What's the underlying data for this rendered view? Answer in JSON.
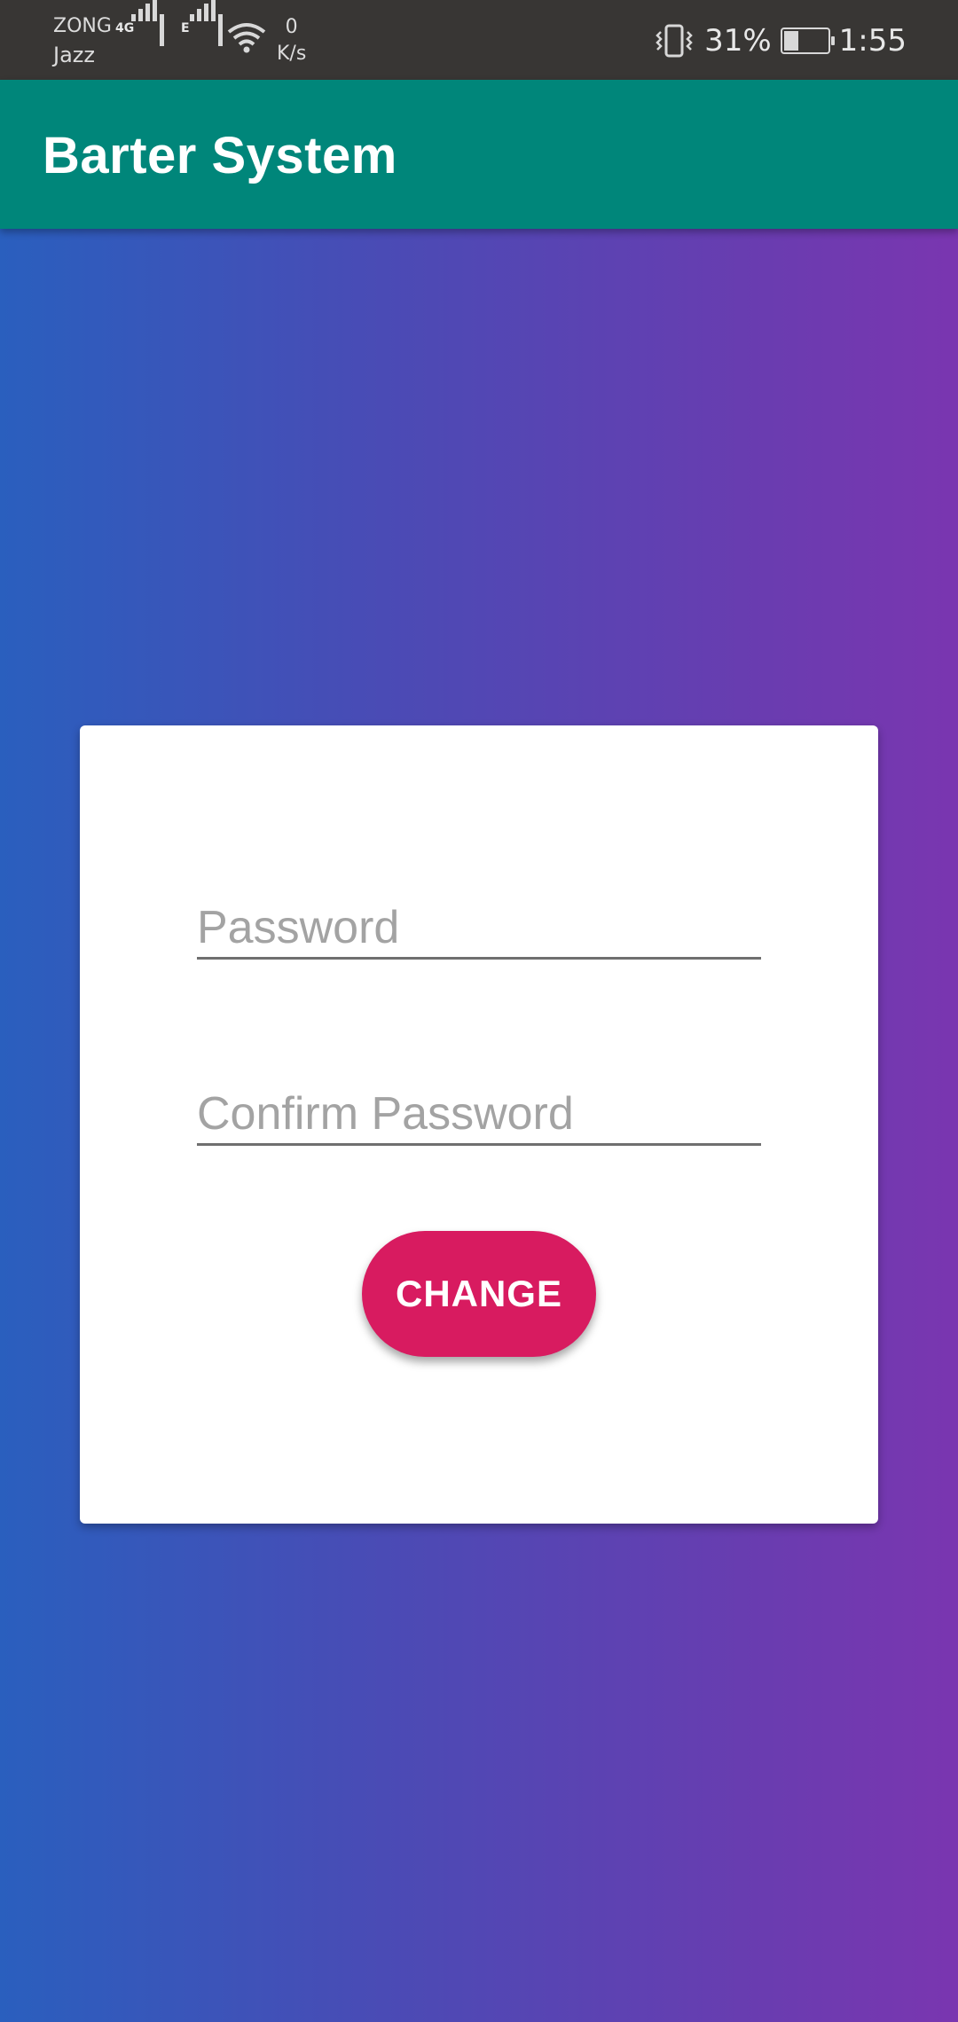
{
  "status_bar": {
    "carrier_1": "ZONG",
    "carrier_2": "Jazz",
    "network_1": "4G",
    "network_2": "E",
    "speed_value": "0",
    "speed_unit": "K/s",
    "battery_percent": "31%",
    "battery_level": 0.31,
    "time": "1:55",
    "icons": [
      "signal-icon",
      "wifi-icon",
      "vibrate-icon",
      "battery-charging-icon"
    ]
  },
  "app_bar": {
    "title": "Barter System",
    "color": "#00867a"
  },
  "form": {
    "password_placeholder": "Password",
    "password_value": "",
    "confirm_placeholder": "Confirm Password",
    "confirm_value": "",
    "change_label": "CHANGE",
    "button_color": "#d81b60"
  },
  "colors": {
    "gradient_start": "#2a5fbe",
    "gradient_end": "#7a36b0",
    "card": "#ffffff"
  }
}
